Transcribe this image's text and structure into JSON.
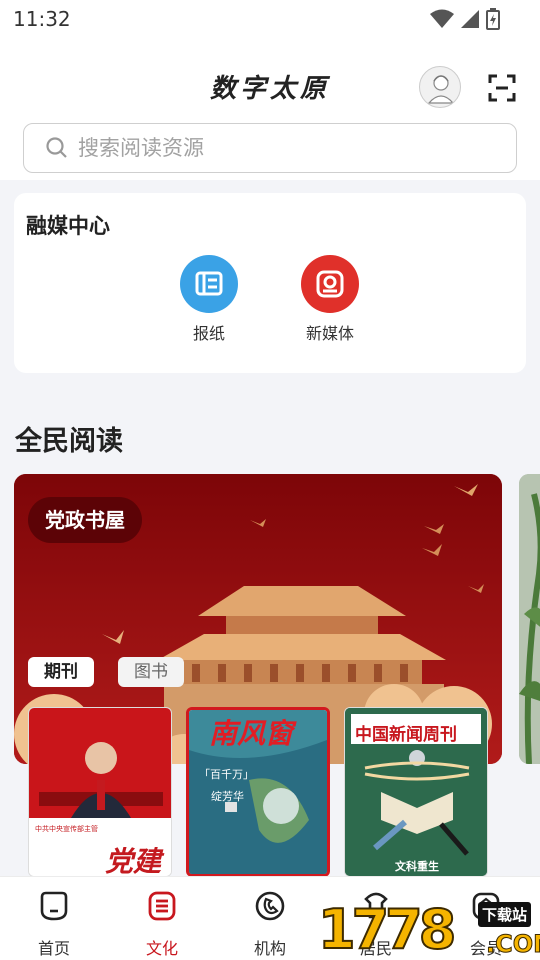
{
  "status": {
    "time": "11:32"
  },
  "header": {
    "title": "数字太原"
  },
  "search": {
    "placeholder": "搜索阅读资源"
  },
  "media_center": {
    "title": "融媒中心",
    "items": [
      {
        "label": "报纸",
        "icon": "newspaper-icon",
        "color": "#3aa2e6"
      },
      {
        "label": "新媒体",
        "icon": "new-media-icon",
        "color": "#e0302a"
      }
    ]
  },
  "reading": {
    "title": "全民阅读",
    "banner_tag": "党政书屋",
    "tabs": [
      "期刊",
      "图书"
    ]
  },
  "covers": [
    {
      "masthead": "党建",
      "small": "中共中央宣传部主管"
    },
    {
      "masthead": "南风窗",
      "sub1": "「百千万」",
      "sub2": "绽芳华"
    },
    {
      "masthead": "中国新闻周刊",
      "sub": "文科重生"
    }
  ],
  "tabbar": [
    {
      "label": "首页",
      "icon": "home-icon"
    },
    {
      "label": "文化",
      "icon": "culture-icon"
    },
    {
      "label": "机构",
      "icon": "institution-icon"
    },
    {
      "label": "居民",
      "icon": "resident-icon"
    },
    {
      "label": "会员",
      "icon": "member-icon"
    }
  ],
  "watermark": {
    "digits": "1778",
    "tag": "下载站",
    "domain": ".COM"
  },
  "colors": {
    "accent": "#c8171e",
    "banner_red": "#8f0d0e",
    "gold": "#e9b178"
  }
}
